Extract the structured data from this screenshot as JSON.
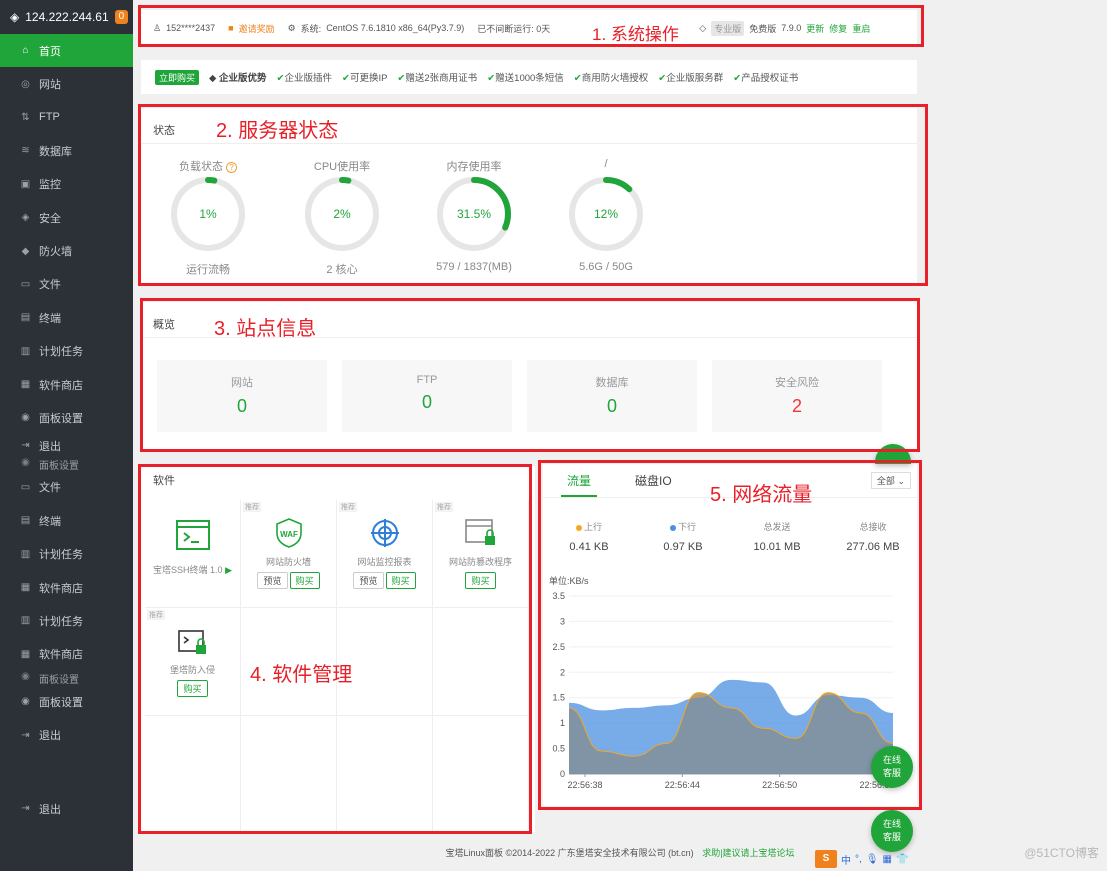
{
  "sidebar": {
    "ip": "124.222.244.61",
    "badge": "0",
    "items": [
      {
        "label": "首页",
        "icon": "home-icon"
      },
      {
        "label": "网站",
        "icon": "globe-icon"
      },
      {
        "label": "FTP",
        "icon": "ftp-icon"
      },
      {
        "label": "数据库",
        "icon": "database-icon"
      },
      {
        "label": "监控",
        "icon": "monitor-icon"
      },
      {
        "label": "安全",
        "icon": "shield-icon"
      },
      {
        "label": "防火墙",
        "icon": "firewall-icon"
      },
      {
        "label": "文件",
        "icon": "folder-icon"
      },
      {
        "label": "终端",
        "icon": "terminal-icon"
      },
      {
        "label": "计划任务",
        "icon": "calendar-icon"
      },
      {
        "label": "软件商店",
        "icon": "apps-icon"
      },
      {
        "label": "面板设置",
        "icon": "settings-icon"
      },
      {
        "label": "退出",
        "icon": "logout-icon"
      },
      {
        "label": "面板设置",
        "icon": "settings-icon"
      },
      {
        "label": "文件",
        "icon": "folder-icon"
      },
      {
        "label": "终端",
        "icon": "terminal-icon"
      },
      {
        "label": "计划任务",
        "icon": "calendar-icon"
      },
      {
        "label": "软件商店",
        "icon": "apps-icon"
      },
      {
        "label": "计划任务",
        "icon": "calendar-icon"
      },
      {
        "label": "软件商店",
        "icon": "apps-icon"
      },
      {
        "label": "面板设置",
        "icon": "settings-icon"
      },
      {
        "label": "面板设置",
        "icon": "settings-icon"
      },
      {
        "label": "退出",
        "icon": "logout-icon"
      },
      {
        "label": "退出",
        "icon": "logout-icon"
      }
    ]
  },
  "topbar": {
    "user": "152****2437",
    "invite": "邀请奖励",
    "system_label": "系统:",
    "system": "CentOS 7.6.1810 x86_64(Py3.7.9)",
    "uptime": "已不间断运行: 0天",
    "pro": "专业版",
    "edition": "免费版",
    "version": "7.9.0",
    "update": "更新",
    "repair": "修复",
    "restart": "重启"
  },
  "promo": {
    "buy": "立即购买",
    "title": "企业版优势",
    "features": [
      "企业版插件",
      "可更换IP",
      "赠送2张商用证书",
      "赠送1000条短信",
      "商用防火墙授权",
      "企业版服务群",
      "产品授权证书"
    ]
  },
  "status": {
    "title": "状态",
    "gauges": [
      {
        "title": "负载状态",
        "value": "1%",
        "fraction": 0.01,
        "sub": "运行流畅",
        "color": "#20a53a"
      },
      {
        "title": "CPU使用率",
        "value": "2%",
        "fraction": 0.02,
        "sub": "2 核心",
        "color": "#20a53a"
      },
      {
        "title": "内存使用率",
        "value": "31.5%",
        "fraction": 0.315,
        "sub": "579 / 1837(MB)",
        "color": "#20a53a"
      },
      {
        "title": "/",
        "value": "12%",
        "fraction": 0.12,
        "sub": "5.6G / 50G",
        "color": "#20a53a"
      }
    ]
  },
  "overview": {
    "title": "概览",
    "cards": [
      {
        "label": "网站",
        "value": "0"
      },
      {
        "label": "FTP",
        "value": "0"
      },
      {
        "label": "数据库",
        "value": "0"
      },
      {
        "label": "安全风险",
        "value": "2"
      }
    ]
  },
  "software": {
    "title": "软件",
    "recommend": "推荐",
    "preview": "预览",
    "buy": "购买",
    "ssh": "宝塔SSH终端 1.0",
    "waf": "网站防火墙",
    "monitor": "网站监控报表",
    "tamper": "网站防篡改程序",
    "intrusion": "堡塔防入侵"
  },
  "network": {
    "tabs": [
      "流量",
      "磁盘IO"
    ],
    "range": "全部",
    "stats": [
      {
        "label": "上行",
        "value": "0.41 KB",
        "dot": "#f5a623"
      },
      {
        "label": "下行",
        "value": "0.97 KB",
        "dot": "#4a90e2"
      },
      {
        "label": "总发送",
        "value": "10.01 MB"
      },
      {
        "label": "总接收",
        "value": "277.06 MB"
      }
    ]
  },
  "chart_data": {
    "type": "area",
    "ylabel": "单位:KB/s",
    "ylim": [
      0,
      3.5
    ],
    "yticks": [
      "0",
      "0.5",
      "1",
      "1.5",
      "2",
      "2.5",
      "3",
      "3.5"
    ],
    "x": [
      "22:56:38",
      "22:56:44",
      "22:56:50",
      "22:56:56"
    ],
    "series": [
      {
        "name": "上行",
        "color": "#f5a623",
        "values": [
          1.3,
          0.45,
          0.35,
          0.6,
          1.6,
          1.3,
          0.9,
          0.7,
          1.6,
          1.2,
          0.6
        ]
      },
      {
        "name": "下行",
        "color": "#4a90e2",
        "values": [
          1.4,
          1.25,
          1.3,
          1.35,
          1.5,
          1.85,
          1.8,
          1.15,
          1.55,
          1.5,
          1.2
        ]
      }
    ]
  },
  "chat": {
    "label1": "在线",
    "label2": "客服"
  },
  "footer": {
    "copyright": "宝塔Linux面板 ©2014-2022 广东堡塔安全技术有限公司 (bt.cn)",
    "link": "求助|建议请上宝塔论坛"
  },
  "ime": {
    "logo": "S",
    "text": "中"
  },
  "annotations": {
    "a1": "1. 系统操作",
    "a2": "2. 服务器状态",
    "a3": "3. 站点信息",
    "a4": "4. 软件管理",
    "a5": "5. 网络流量"
  },
  "watermark": "@51CTO博客"
}
